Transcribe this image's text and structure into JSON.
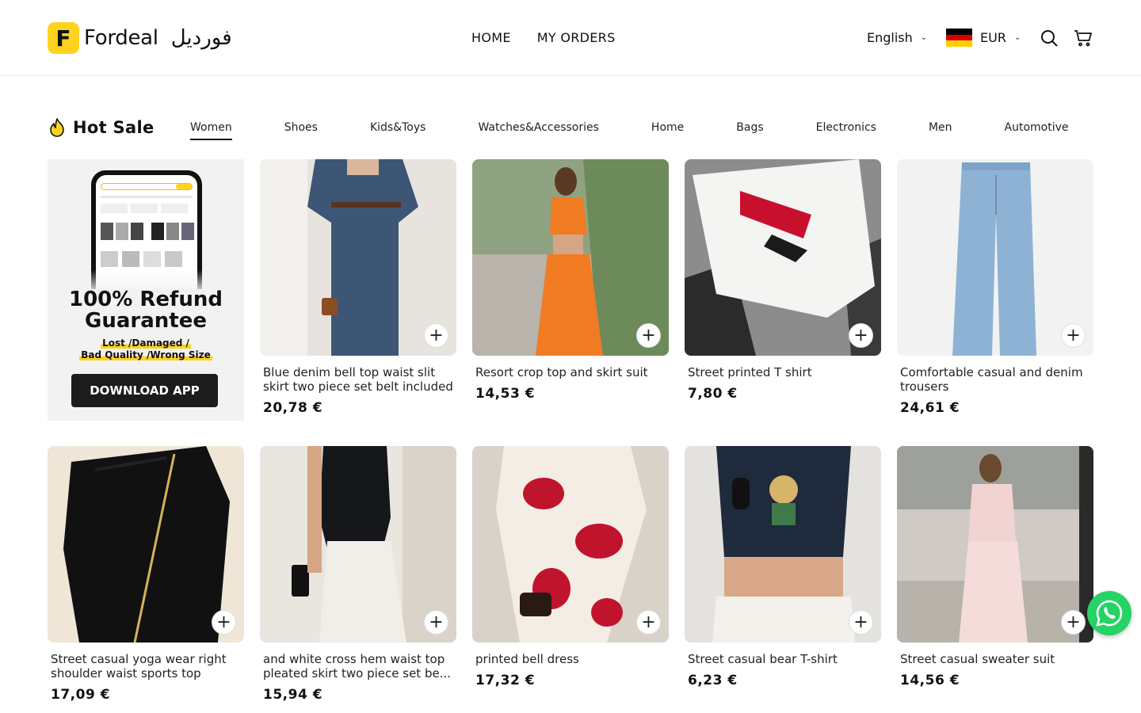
{
  "header": {
    "logo_letter": "F",
    "logo_text": "Fordeal",
    "logo_arabic": "فورديل",
    "nav": [
      "HOME",
      "MY ORDERS"
    ],
    "language": "English",
    "currency": "EUR"
  },
  "section": {
    "title": "Hot Sale",
    "tabs": [
      "Women",
      "Shoes",
      "Kids&Toys",
      "Watches&Accessories",
      "Home",
      "Bags",
      "Electronics",
      "Men",
      "Automotive"
    ],
    "active_tab": "Women"
  },
  "promo": {
    "headline_1": "100% Refund",
    "headline_2": "Guarantee",
    "line_1": "Lost  /Damaged /",
    "line_2": "Bad Quality /Wrong Size",
    "button": "DOWNLOAD APP"
  },
  "products": [
    {
      "title": "Blue denim bell top waist slit skirt two piece set belt included",
      "price": "20,78 €"
    },
    {
      "title": "Resort crop top and skirt suit",
      "price": "14,53 €"
    },
    {
      "title": "Street printed T shirt",
      "price": "7,80 €"
    },
    {
      "title": "Comfortable casual and denim trousers",
      "price": "24,61 €"
    },
    {
      "title": "Street casual yoga wear right shoulder waist sports top",
      "price": "17,09 €"
    },
    {
      "title": "and white cross hem waist top pleated skirt two piece set be...",
      "price": "15,94 €"
    },
    {
      "title": "printed bell dress",
      "price": "17,32 €"
    },
    {
      "title": "Street casual bear T-shirt",
      "price": "6,23 €"
    },
    {
      "title": "Street casual sweater suit",
      "price": "14,56 €"
    }
  ],
  "colors": {
    "brand_yellow": "#ffd21f",
    "whatsapp_green": "#25d366",
    "button_dark": "#1c1c1c"
  },
  "icons": [
    "search-icon",
    "cart-icon",
    "fire-icon",
    "plus-icon",
    "whatsapp-icon",
    "chevron-down-icon",
    "germany-flag-icon"
  ]
}
